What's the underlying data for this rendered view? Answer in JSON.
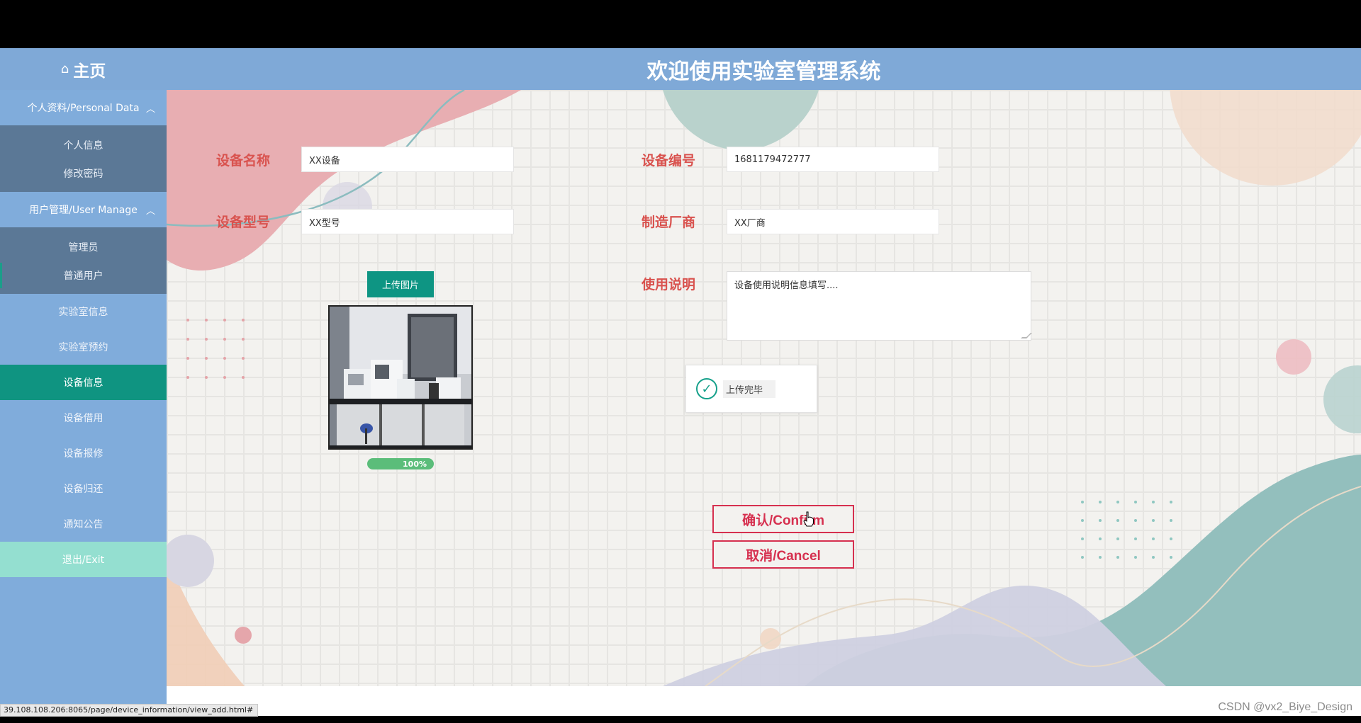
{
  "header": {
    "home_icon": "home-icon",
    "home_label": "主页",
    "title": "欢迎使用实验室管理系统"
  },
  "sidebar": {
    "group_personal": {
      "label": "个人资料/Personal Data",
      "expanded": true,
      "items": [
        "个人信息",
        "修改密码"
      ]
    },
    "group_users": {
      "label": "用户管理/User Manage",
      "expanded": true,
      "items": [
        "管理员",
        "普通用户"
      ]
    },
    "items": [
      "实验室信息",
      "实验室预约",
      "设备信息",
      "设备借用",
      "设备报修",
      "设备归还",
      "通知公告"
    ],
    "active_item": "设备信息",
    "exit_label": "退出/Exit"
  },
  "form": {
    "name_label": "设备名称",
    "name_value": "XX设备",
    "code_label": "设备编号",
    "code_value": "1681179472777",
    "model_label": "设备型号",
    "model_value": "XX型号",
    "maker_label": "制造厂商",
    "maker_value": "XX厂商",
    "usage_label": "使用说明",
    "usage_value": "设备使用说明信息填写....",
    "upload_label": "上传图片",
    "upload_progress": "100%",
    "toast_message": "上传完毕",
    "confirm_label": "确认/Confirm",
    "cancel_label": "取消/Cancel"
  },
  "status_url": "39.108.108.206:8065/page/device_information/view_add.html#",
  "watermark": "CSDN @vx2_Biye_Design",
  "colors": {
    "header_bg": "#7fa9d7",
    "sidebar_bg": "#80acdb",
    "submenu_bg": "#5b7896",
    "active_bg": "#0f9481",
    "exit_bg": "#94dfd0",
    "label_red": "#d9534f",
    "button_red": "#d6304f"
  }
}
